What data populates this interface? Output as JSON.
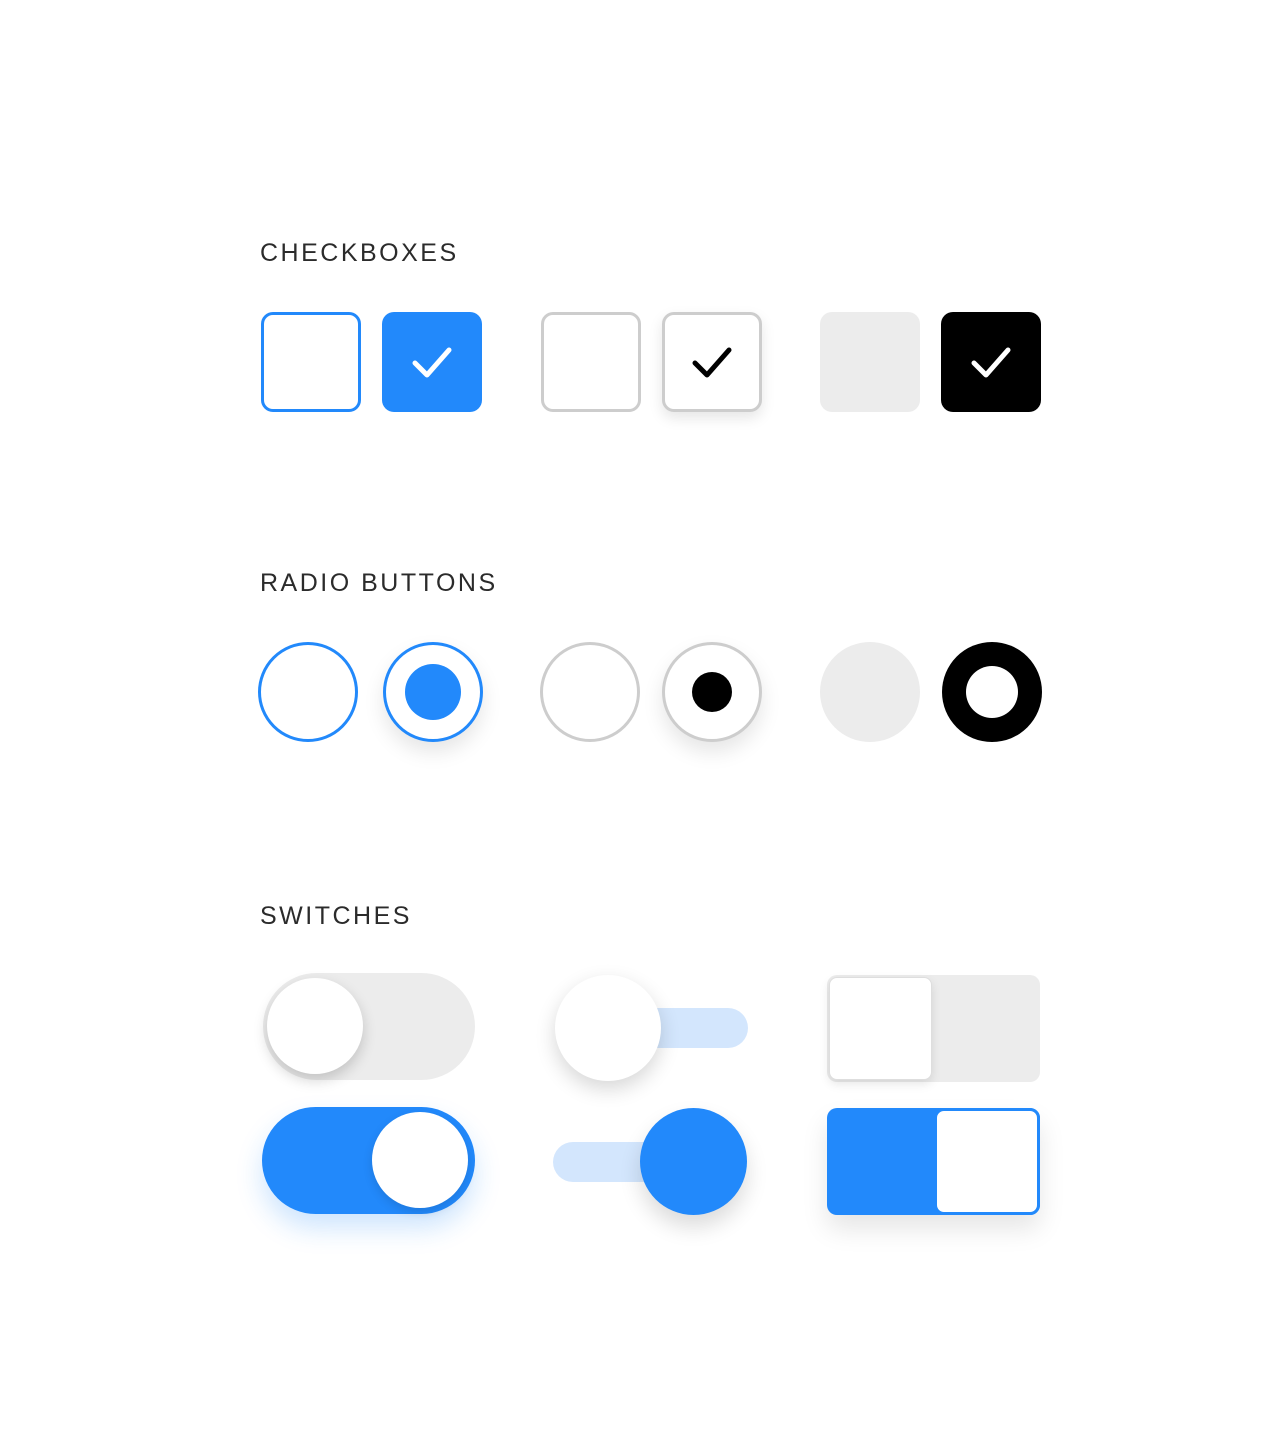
{
  "sections": {
    "checkboxes": {
      "title": "CHECKBOXES"
    },
    "radios": {
      "title": "RADIO BUTTONS"
    },
    "switches": {
      "title": "SWITCHES"
    }
  },
  "colors": {
    "accent": "#2289fb",
    "accent_light": "#d3e6fd",
    "border_grey": "#cdcdcd",
    "fill_grey": "#ececec",
    "black": "#000000",
    "heading_text": "#2b2b2b"
  },
  "checkboxes": [
    {
      "style": "blue-outline",
      "checked": false
    },
    {
      "style": "blue-outline",
      "checked": true,
      "icon": "checkmark-icon"
    },
    {
      "style": "grey-outline",
      "checked": false
    },
    {
      "style": "grey-outline",
      "checked": true,
      "icon": "checkmark-icon"
    },
    {
      "style": "filled",
      "checked": false
    },
    {
      "style": "filled",
      "checked": true,
      "icon": "checkmark-icon"
    }
  ],
  "radios": [
    {
      "style": "blue-outline",
      "selected": false
    },
    {
      "style": "blue-outline",
      "selected": true
    },
    {
      "style": "grey-outline",
      "selected": false
    },
    {
      "style": "grey-outline",
      "selected": true
    },
    {
      "style": "filled",
      "selected": false
    },
    {
      "style": "filled",
      "selected": true
    }
  ],
  "switches": [
    {
      "style": "pill",
      "on": false
    },
    {
      "style": "thin-track",
      "on": false
    },
    {
      "style": "square",
      "on": false
    },
    {
      "style": "pill",
      "on": true
    },
    {
      "style": "thin-track",
      "on": true
    },
    {
      "style": "square",
      "on": true
    }
  ]
}
